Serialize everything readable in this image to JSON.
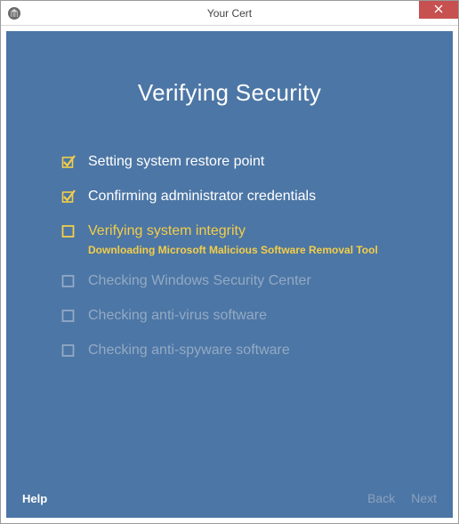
{
  "titlebar": {
    "title": "Your Cert"
  },
  "heading": "Verifying Security",
  "colors": {
    "accent": "#f3ce49",
    "panel": "#4c76a5",
    "pending": "#93aac5",
    "close": "#c75050"
  },
  "steps": [
    {
      "label": "Setting system restore point",
      "status": "done",
      "icon": "check-icon"
    },
    {
      "label": "Confirming administrator credentials",
      "status": "done",
      "icon": "check-icon"
    },
    {
      "label": "Verifying system integrity",
      "status": "current",
      "icon": "box-icon",
      "sub": "Downloading Microsoft Malicious Software Removal Tool"
    },
    {
      "label": "Checking Windows Security Center",
      "status": "pending",
      "icon": "box-icon"
    },
    {
      "label": "Checking anti-virus software",
      "status": "pending",
      "icon": "box-icon"
    },
    {
      "label": "Checking anti-spyware software",
      "status": "pending",
      "icon": "box-icon"
    }
  ],
  "footer": {
    "help": "Help",
    "back": "Back",
    "next": "Next"
  }
}
